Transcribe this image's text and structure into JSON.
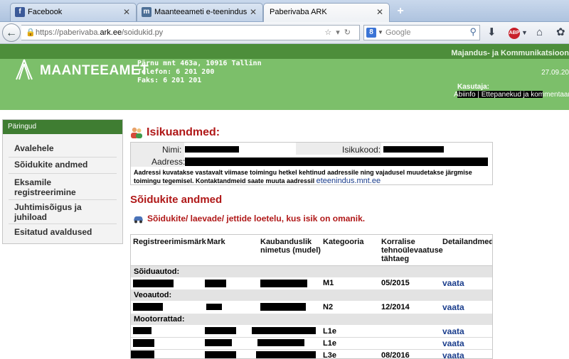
{
  "browser": {
    "tabs": [
      {
        "label": "Facebook",
        "icon": "f"
      },
      {
        "label": "Maanteeameti e-teenindus",
        "icon": "m"
      },
      {
        "label": "Paberivaba ARK",
        "icon": ""
      }
    ],
    "new_tab": "+",
    "close_glyph": "✕",
    "url_scheme_prefix": "https://paberivaba.",
    "url_domain": "ark.ee",
    "url_path": "/soidukid.py",
    "search_placeholder": "Google",
    "search_engine_icon": "8"
  },
  "site": {
    "ministry": "Majandus- ja Kommunikatsioon",
    "logo_text": "MAANTEEAMET",
    "address": "Pärnu mnt 463a, 10916 Tallinn",
    "phone": "Telefon: 6 201 200",
    "fax": "Faks: 6 201 201",
    "date": "27.09.20",
    "user_label": "Kasutaja:",
    "header_links": "Abiinfo | Ettepanekud ja kommentaarid"
  },
  "sidebar": {
    "heading": "Päringud",
    "items": [
      {
        "label": "Avalehele"
      },
      {
        "label": "Sõidukite andmed"
      },
      {
        "label": "Eksamile registreerimine"
      },
      {
        "label": "Juhtimisõigus ja juhiload"
      },
      {
        "label": "Esitatud avaldused"
      }
    ]
  },
  "person": {
    "title": "Isikuandmed:",
    "name_label": "Nimi:",
    "id_label": "Isikukood:",
    "address_label": "Aadress:",
    "note": "Aadressi kuvatakse vastavalt viimase toimingu hetkel kehtinud aadressile ning vajadusel muudetakse järgmise toimingu tegemisel. Kontaktandmeid saate muuta aadressil",
    "note_link": "eteenindus.mnt.ee"
  },
  "vehicles": {
    "title": "Sõidukite andmed",
    "subtitle": "Sõidukite/ laevade/ jettide loetelu, kus isik on omanik.",
    "columns": {
      "reg": "Registreerimismärk",
      "make": "Mark",
      "model": "Kaubanduslik nimetus (mudel)",
      "category": "Kategooria",
      "inspection": "Korralise tehnoülevaatuse tähtaeg",
      "details": "Detailandmed"
    },
    "groups": {
      "cars": "Sõiduautod:",
      "trucks": "Veoautod:",
      "motorcycles": "Mootorrattad:"
    },
    "rows": [
      {
        "category": "M1",
        "inspection": "05/2015",
        "link": "vaata"
      },
      {
        "category": "N2",
        "inspection": "12/2014",
        "link": "vaata"
      },
      {
        "category": "L1e",
        "inspection": "",
        "link": "vaata"
      },
      {
        "category": "L1e",
        "inspection": "",
        "link": "vaata"
      },
      {
        "category": "L3e",
        "inspection": "08/2016",
        "link": "vaata"
      }
    ]
  },
  "colors": {
    "header_green": "#7cbf6a",
    "strip_green": "#4d8e3b",
    "section_red": "#b01818",
    "link_blue": "#1a3d8c"
  }
}
